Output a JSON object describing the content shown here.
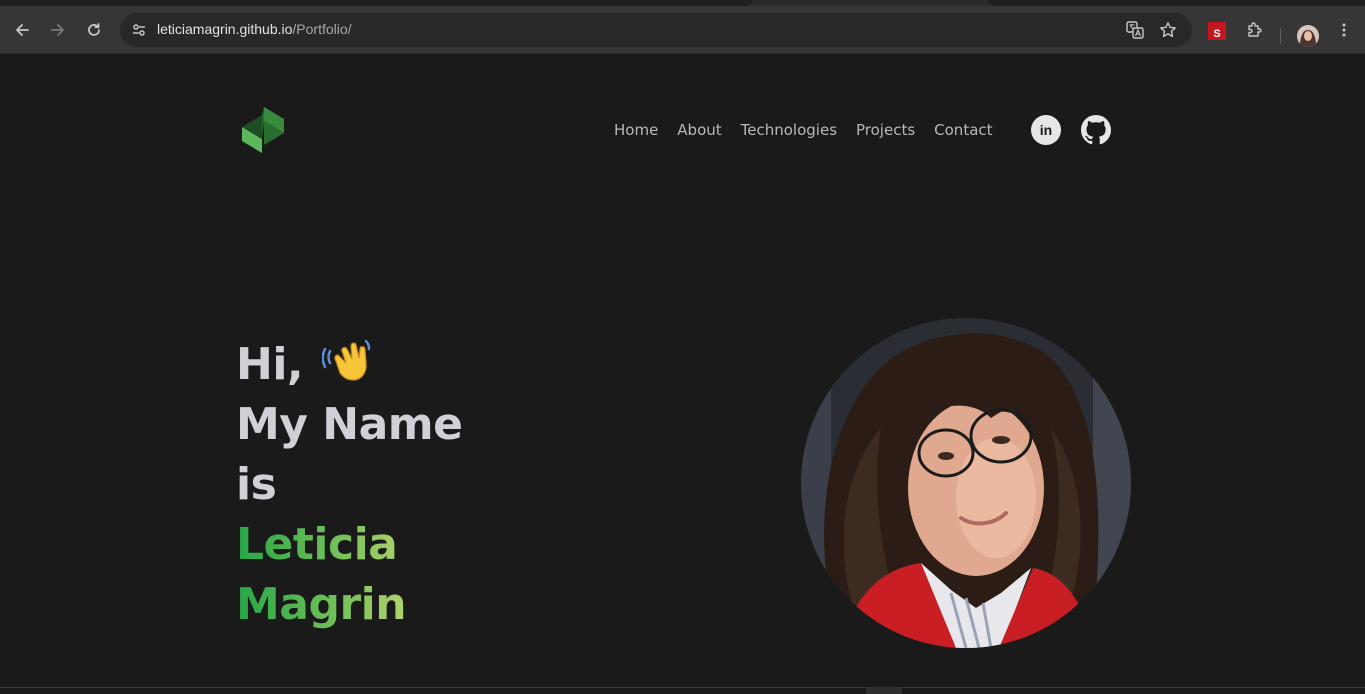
{
  "browser": {
    "url_host": "leticiamagrin.github.io",
    "url_path": "/Portfolio/",
    "extension_label": "S",
    "icons": [
      "back-arrow-icon",
      "forward-arrow-icon",
      "reload-icon",
      "site-info-icon",
      "translate-icon",
      "bookmark-star-icon",
      "extensions-icon",
      "kebab-menu-icon"
    ]
  },
  "nav": {
    "items": [
      {
        "label": "Home"
      },
      {
        "label": "About"
      },
      {
        "label": "Technologies"
      },
      {
        "label": "Projects"
      },
      {
        "label": "Contact"
      }
    ],
    "linkedin_label": "in"
  },
  "hero": {
    "greeting": "Hi,",
    "line2": "My Name",
    "line3": "is",
    "first_name": "Leticia",
    "last_name": "Magrin"
  },
  "colors": {
    "background": "#1a1a1a",
    "text": "#d0d0d6",
    "accent_start": "#26a747",
    "accent_end": "#e6e080"
  }
}
